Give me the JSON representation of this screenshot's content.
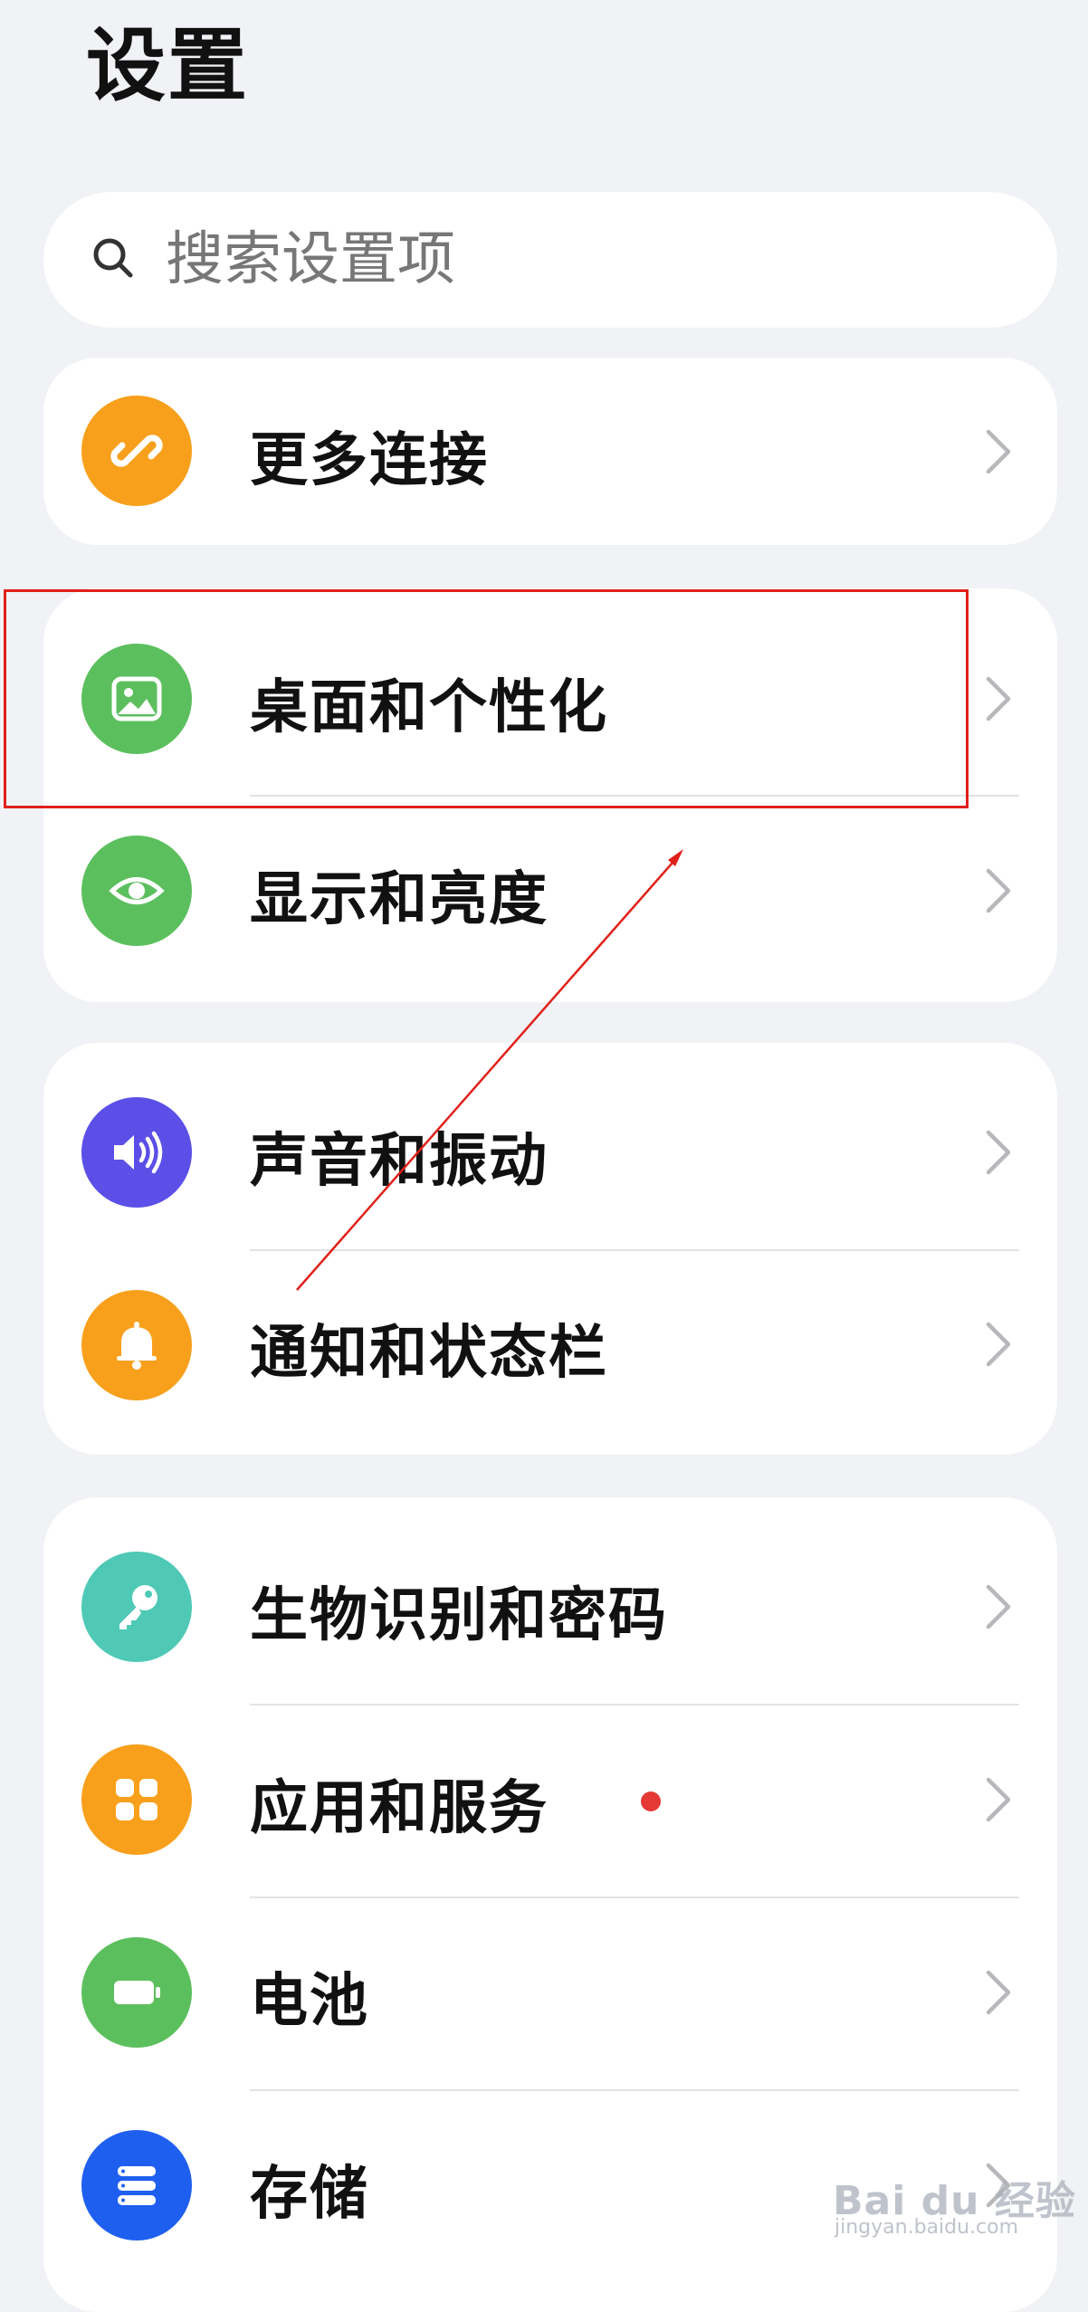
{
  "page": {
    "title": "设置"
  },
  "search": {
    "placeholder": "搜索设置项"
  },
  "sections": [
    {
      "items": [
        {
          "label": "更多连接",
          "icon": "link-icon",
          "color": "#f8a01c"
        }
      ]
    },
    {
      "items": [
        {
          "label": "桌面和个性化",
          "icon": "image-icon",
          "color": "#5cbf5e"
        },
        {
          "label": "显示和亮度",
          "icon": "eye-icon",
          "color": "#5cbf5e"
        }
      ]
    },
    {
      "items": [
        {
          "label": "声音和振动",
          "icon": "speaker-icon",
          "color": "#5b4fe8"
        },
        {
          "label": "通知和状态栏",
          "icon": "bell-icon",
          "color": "#f8a01c"
        }
      ]
    },
    {
      "items": [
        {
          "label": "生物识别和密码",
          "icon": "key-icon",
          "color": "#4fc9b5"
        },
        {
          "label": "应用和服务",
          "icon": "apps-icon",
          "color": "#f8a01c",
          "badge_color": "#e53935"
        },
        {
          "label": "电池",
          "icon": "battery-icon",
          "color": "#5cbf5e"
        },
        {
          "label": "存储",
          "icon": "storage-icon",
          "color": "#1f5ff0"
        }
      ]
    }
  ],
  "annotation": {
    "color": "#e0201a"
  },
  "watermark": {
    "text": "Bai du 经验",
    "sub": "jingyan.baidu.com"
  }
}
